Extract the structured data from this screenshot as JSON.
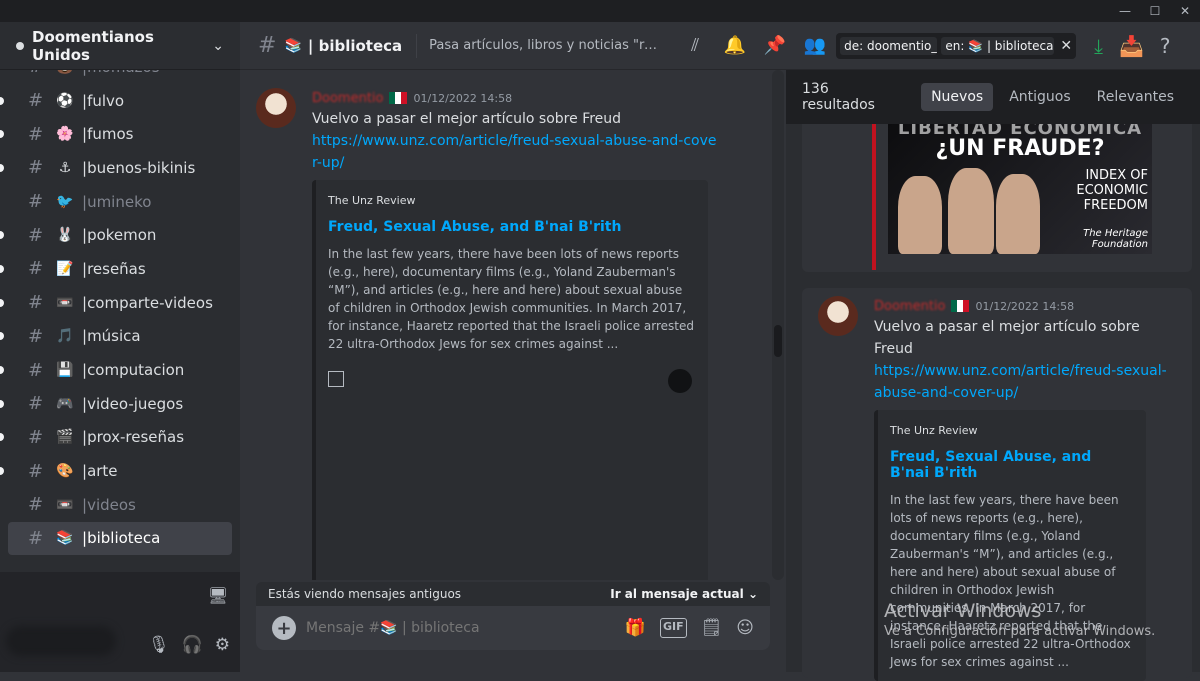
{
  "server": {
    "name": "Doomentianos Unidos"
  },
  "channels": [
    {
      "emoji": "💩",
      "name": "momazos",
      "muted": true
    },
    {
      "emoji": "⚽",
      "name": "fulvo"
    },
    {
      "emoji": "🌸",
      "name": "fumos"
    },
    {
      "emoji": "⚓",
      "name": "buenos-bikinis"
    },
    {
      "emoji": "🐦",
      "name": "umineko",
      "muted": true
    },
    {
      "emoji": "🐰",
      "name": "pokemon"
    },
    {
      "emoji": "📝",
      "name": "reseñas"
    },
    {
      "emoji": "📼",
      "name": "comparte-videos"
    },
    {
      "emoji": "🎵",
      "name": "música"
    },
    {
      "emoji": "💾",
      "name": "computacion"
    },
    {
      "emoji": "🎮",
      "name": "video-juegos"
    },
    {
      "emoji": "🎬",
      "name": "prox-reseñas"
    },
    {
      "emoji": "🎨",
      "name": "arte"
    },
    {
      "emoji": "📼",
      "name": "videos",
      "muted": true
    },
    {
      "emoji": "📚",
      "name": "biblioteca",
      "active": true
    }
  ],
  "topbar": {
    "channel_emoji": "📚",
    "channel_name": "| biblioteca",
    "topic": "Pasa artículos, libros y noticias \"relevantes\" aquí",
    "search_from": "de: doomentio_",
    "search_in": "en: 📚 | biblioteca"
  },
  "message": {
    "author": "Doomentio",
    "timestamp": "01/12/2022 14:58",
    "text": "Vuelvo a pasar el mejor artículo sobre Freud",
    "link": "https://www.unz.com/article/freud-sexual-abuse-and-cover-up/",
    "embed": {
      "provider": "The Unz Review",
      "title": "Freud, Sexual Abuse, and B'nai B'rith",
      "description": "In the last few years, there have been lots of news reports (e.g., here), documentary films (e.g., Yoland Zauberman's “M”), and articles (e.g., here and here) about sexual abuse of children in Orthodox Jewish communities. In March 2017, for instance, Haaretz reported that the Israeli police arrested 22 ultra-Orthodox Jews for sex crimes against ..."
    }
  },
  "old_messages_bar": {
    "text": "Estás viendo mensajes antiguos",
    "jump": "Ir al mensaje actual"
  },
  "composer": {
    "placeholder": "Mensaje #📚 | biblioteca"
  },
  "search_panel": {
    "count": "136 resultados",
    "tabs": [
      "Nuevos",
      "Antiguos",
      "Relevantes"
    ],
    "thumb_text": {
      "line1": "LIBERTAD ECONÓMICA",
      "line2": "¿UN FRAUDE?",
      "line3": "INDEX OF ECONOMIC FREEDOM",
      "line4": "The Heritage Foundation"
    }
  },
  "watermark": {
    "title": "Activar Windows",
    "subtitle": "Ve a Configuración para activar Windows."
  }
}
